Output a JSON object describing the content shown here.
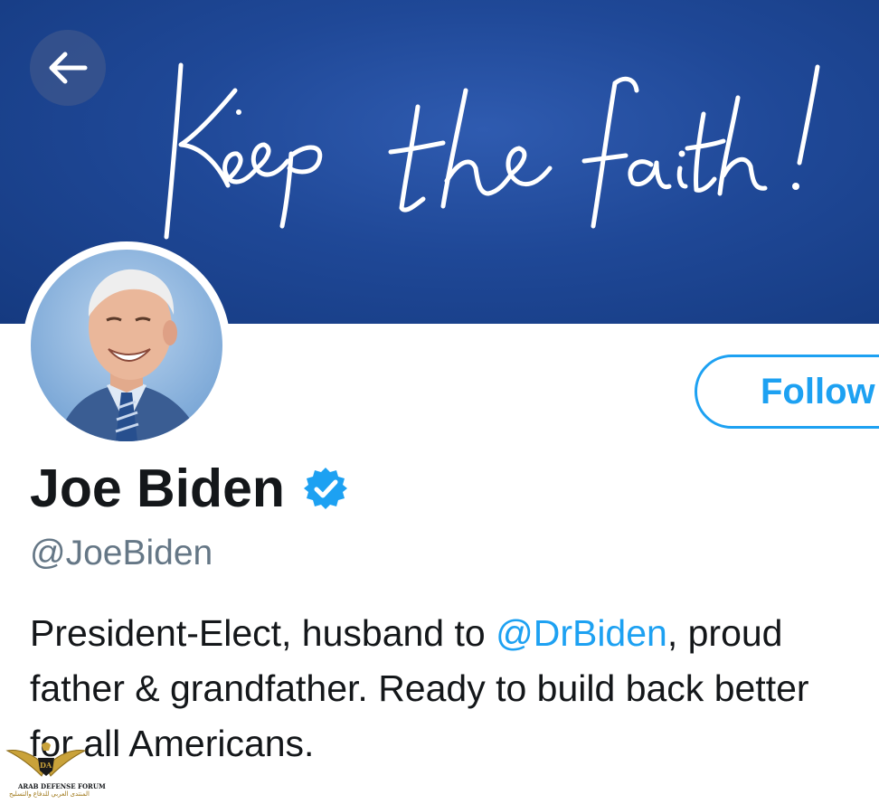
{
  "header": {
    "back_icon": "arrow-left-icon",
    "banner_text": "Keep the faith!",
    "banner_color": "#1f4897"
  },
  "profile": {
    "name": "Joe Biden",
    "verified_icon": "verified-badge-icon",
    "handle": "@JoeBiden",
    "follow_label": "Follow",
    "bio": {
      "part1": "President-Elect, husband to ",
      "mention": "@DrBiden",
      "part2": ", proud",
      "line2": "father & grandfather. Ready to build back better",
      "line3": "for all Americans."
    }
  },
  "watermark": {
    "logo": "DA",
    "line1": "ARAB DEFENSE FORUM",
    "line2": "المنتدى العربي للدفاع والتسليح"
  },
  "colors": {
    "accent": "#1da1f2",
    "text": "#14171a",
    "secondary": "#657786"
  }
}
